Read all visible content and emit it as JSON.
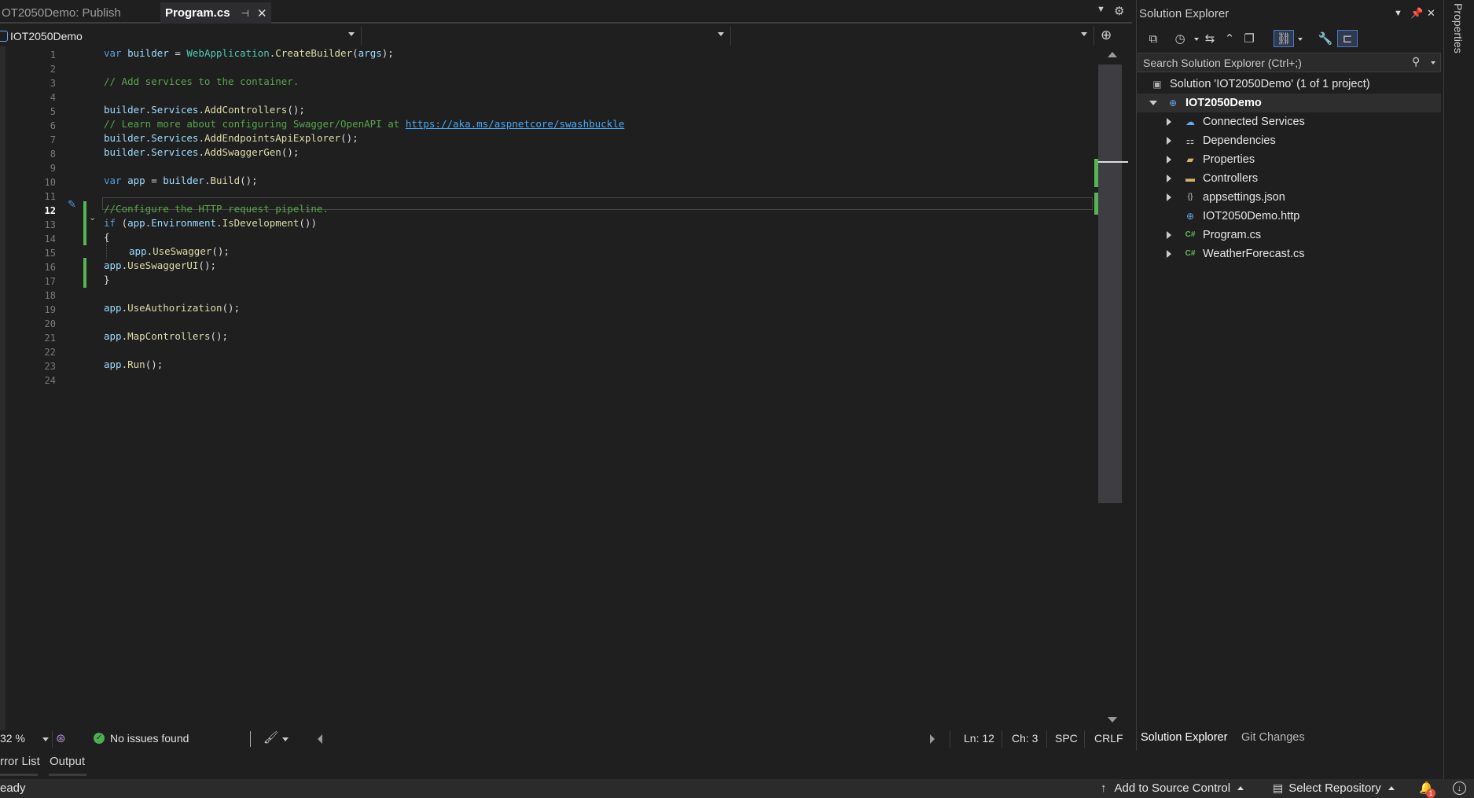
{
  "tabs": {
    "publish": "OT2050Demo: Publish",
    "program": "Program.cs",
    "pin_glyph": "⊣",
    "close_glyph": "✕"
  },
  "navbar": {
    "project": "IOT2050Demo",
    "type": "",
    "member": ""
  },
  "editor": {
    "line_numbers": [
      "1",
      "2",
      "3",
      "4",
      "5",
      "6",
      "7",
      "8",
      "9",
      "10",
      "11",
      "12",
      "13",
      "14",
      "15",
      "16",
      "17",
      "18",
      "19",
      "20",
      "21",
      "22",
      "23",
      "24"
    ],
    "current_line": "12",
    "code": {
      "l1": {
        "kw": "var",
        "var": "builder",
        "eq": " = ",
        "cls": "WebApplication",
        "dot": ".",
        "mth": "CreateBuilder",
        "open": "(",
        "arg": "args",
        "close": ");"
      },
      "l3": "// Add services to the container.",
      "l5": {
        "obj": "builder",
        "d1": ".",
        "prop": "Services",
        "d2": ".",
        "mth": "AddControllers",
        "tail": "();"
      },
      "l6": {
        "cmt": "// Learn more about configuring Swagger/OpenAPI at ",
        "link": "https://aka.ms/aspnetcore/swashbuckle"
      },
      "l7": {
        "obj": "builder",
        "d1": ".",
        "prop": "Services",
        "d2": ".",
        "mth": "AddEndpointsApiExplorer",
        "tail": "();"
      },
      "l8": {
        "obj": "builder",
        "d1": ".",
        "prop": "Services",
        "d2": ".",
        "mth": "AddSwaggerGen",
        "tail": "();"
      },
      "l10": {
        "kw": "var",
        "var": "app",
        "eq": " = ",
        "obj": "builder",
        "d1": ".",
        "mth": "Build",
        "tail": "();"
      },
      "l12": "//Configure the HTTP request pipeline.",
      "l13": {
        "kw": "if",
        "open": " (",
        "obj": "app",
        "d1": ".",
        "prop": "Environment",
        "d2": ".",
        "mth": "IsDevelopment",
        "tail": "())"
      },
      "l14": "{",
      "l15": {
        "obj": "app",
        "d1": ".",
        "mth": "UseSwagger",
        "tail": "();"
      },
      "l16": {
        "obj": "app",
        "d1": ".",
        "mth": "UseSwaggerUI",
        "tail": "();"
      },
      "l17": "}",
      "l19": {
        "obj": "app",
        "d1": ".",
        "mth": "UseAuthorization",
        "tail": "();"
      },
      "l21": {
        "obj": "app",
        "d1": ".",
        "mth": "MapControllers",
        "tail": "();"
      },
      "l23": {
        "obj": "app",
        "d1": ".",
        "mth": "Run",
        "tail": "();"
      }
    }
  },
  "editor_status": {
    "zoom": "32 %",
    "issues": "No issues found",
    "ln": "Ln: 12",
    "ch": "Ch: 3",
    "indent": "SPC",
    "eol": "CRLF"
  },
  "bottom_tabs": {
    "error_list": "rror List",
    "output": "Output"
  },
  "statusbar": {
    "ready": "eady",
    "source_control": "Add to Source Control",
    "select_repo": "Select Repository",
    "notification_count": "1"
  },
  "solution_explorer": {
    "title": "Solution Explorer",
    "search_placeholder": "Search Solution Explorer (Ctrl+;)",
    "solution": "Solution 'IOT2050Demo' (1 of 1 project)",
    "project": "IOT2050Demo",
    "nodes": [
      {
        "label": "Connected Services",
        "icon": "connected-services-icon",
        "expandable": true
      },
      {
        "label": "Dependencies",
        "icon": "dependencies-icon",
        "expandable": true
      },
      {
        "label": "Properties",
        "icon": "properties-folder-icon",
        "expandable": true
      },
      {
        "label": "Controllers",
        "icon": "folder-icon",
        "expandable": true
      },
      {
        "label": "appsettings.json",
        "icon": "json-file-icon",
        "expandable": true
      },
      {
        "label": "IOT2050Demo.http",
        "icon": "http-file-icon",
        "expandable": false
      },
      {
        "label": "Program.cs",
        "icon": "csharp-file-icon",
        "expandable": true
      },
      {
        "label": "WeatherForecast.cs",
        "icon": "csharp-file-icon",
        "expandable": true
      }
    ],
    "csharp_glyph": "C#",
    "bottom_tab_active": "Solution Explorer",
    "bottom_tab_other": "Git Changes"
  },
  "properties_rail": {
    "label": "Properties"
  },
  "colors": {
    "background": "#1f1f1f",
    "keyword": "#569cd6",
    "type": "#4ec9b0",
    "method": "#dcdcaa",
    "comment": "#57a64a",
    "change_margin": "#56b553",
    "link": "#4aa7f6"
  }
}
